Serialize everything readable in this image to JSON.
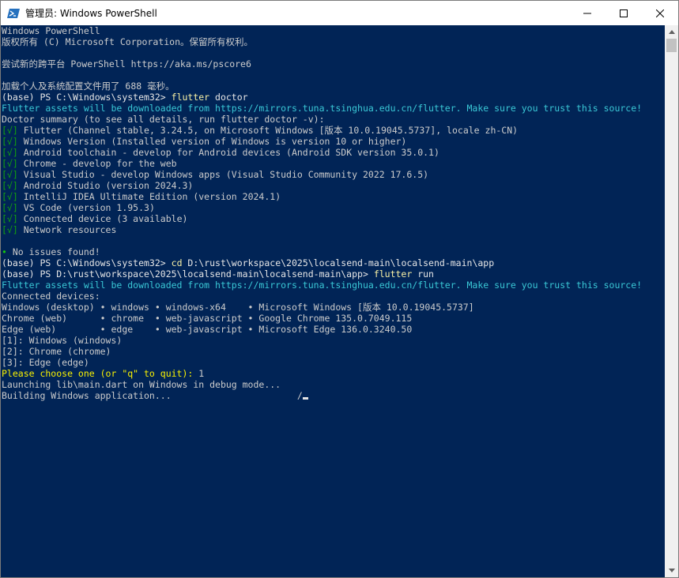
{
  "window": {
    "title": "管理员: Windows PowerShell",
    "icon": "powershell-icon",
    "controls": [
      "minimize-icon",
      "maximize-icon",
      "close-icon"
    ]
  },
  "colors": {
    "console_background": "#012456",
    "text": "#cccccc",
    "command": "#f9f1a5",
    "info": "#3ac8d6",
    "check": "#13a10e",
    "prompt_input": "#f9f100"
  },
  "console": {
    "lines": [
      {
        "text": "Windows PowerShell"
      },
      {
        "text": "版权所有 (C) Microsoft Corporation。保留所有权利。"
      },
      {
        "text": ""
      },
      {
        "text": "尝试新的跨平台 PowerShell https://aka.ms/pscore6"
      },
      {
        "text": ""
      },
      {
        "text": "加载个人及系统配置文件用了 688 毫秒。"
      },
      {
        "prompt": "(base) PS C:\\Windows\\system32> ",
        "cmd": "flutter",
        "args": " doctor"
      },
      {
        "info": "Flutter assets will be downloaded from https://mirrors.tuna.tsinghua.edu.cn/flutter. Make sure you trust this source!"
      },
      {
        "text": "Doctor summary (to see all details, run flutter doctor -v):"
      },
      {
        "check": "[√]",
        "text": " Flutter (Channel stable, 3.24.5, on Microsoft Windows [版本 10.0.19045.5737], locale zh-CN)"
      },
      {
        "check": "[√]",
        "text": " Windows Version (Installed version of Windows is version 10 or higher)"
      },
      {
        "check": "[√]",
        "text": " Android toolchain - develop for Android devices (Android SDK version 35.0.1)"
      },
      {
        "check": "[√]",
        "text": " Chrome - develop for the web"
      },
      {
        "check": "[√]",
        "text": " Visual Studio - develop Windows apps (Visual Studio Community 2022 17.6.5)"
      },
      {
        "check": "[√]",
        "text": " Android Studio (version 2024.3)"
      },
      {
        "check": "[√]",
        "text": " IntelliJ IDEA Ultimate Edition (version 2024.1)"
      },
      {
        "check": "[√]",
        "text": " VS Code (version 1.95.3)"
      },
      {
        "check": "[√]",
        "text": " Connected device (3 available)"
      },
      {
        "check": "[√]",
        "text": " Network resources"
      },
      {
        "text": ""
      },
      {
        "bullet": "•",
        "text": " No issues found!"
      },
      {
        "prompt": "(base) PS C:\\Windows\\system32> ",
        "cmd": "cd",
        "args": " D:\\rust\\workspace\\2025\\localsend-main\\localsend-main\\app"
      },
      {
        "prompt": "(base) PS D:\\rust\\workspace\\2025\\localsend-main\\localsend-main\\app> ",
        "cmd": "flutter",
        "args": " run"
      },
      {
        "info": "Flutter assets will be downloaded from https://mirrors.tuna.tsinghua.edu.cn/flutter. Make sure you trust this source!"
      },
      {
        "text": "Connected devices:"
      },
      {
        "text": "Windows (desktop) • windows • windows-x64    • Microsoft Windows [版本 10.0.19045.5737]"
      },
      {
        "text": "Chrome (web)      • chrome  • web-javascript • Google Chrome 135.0.7049.115"
      },
      {
        "text": "Edge (web)        • edge    • web-javascript • Microsoft Edge 136.0.3240.50"
      },
      {
        "text": "[1]: Windows (windows)"
      },
      {
        "text": "[2]: Chrome (chrome)"
      },
      {
        "text": "[3]: Edge (edge)"
      },
      {
        "ask": "Please choose one (or \"q\" to quit): ",
        "text": "1"
      },
      {
        "text": "Launching lib\\main.dart on Windows in debug mode..."
      },
      {
        "text": "Building Windows application...                       /",
        "cursor": true
      }
    ]
  },
  "scrollbar": {
    "up_icon": "scroll-up-arrow-icon",
    "down_icon": "scroll-down-arrow-icon"
  }
}
